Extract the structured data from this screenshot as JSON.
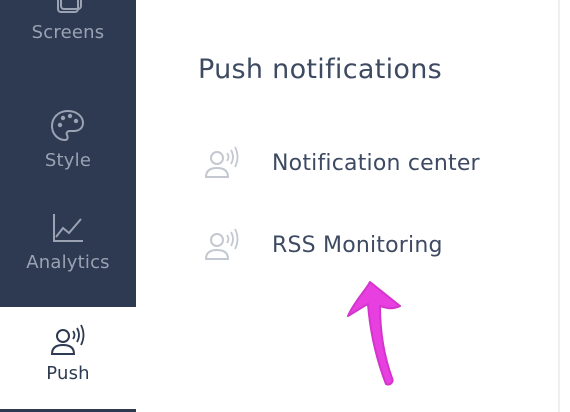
{
  "sidebar": {
    "items": [
      {
        "label": "Screens",
        "icon": "screens-icon"
      },
      {
        "label": "Style",
        "icon": "palette-icon"
      },
      {
        "label": "Analytics",
        "icon": "analytics-chart-icon"
      },
      {
        "label": "Push",
        "icon": "push-user-icon",
        "active": true
      }
    ]
  },
  "main": {
    "title": "Push notifications",
    "items": [
      {
        "label": "Notification center",
        "icon": "push-user-icon"
      },
      {
        "label": "RSS Monitoring",
        "icon": "push-user-icon"
      }
    ]
  },
  "annotation": {
    "arrow_color": "#e840e0",
    "points_to": "RSS Monitoring"
  },
  "colors": {
    "sidebar_bg": "#2e3a52",
    "sidebar_text": "#9aa2b3",
    "active_bg": "#ffffff",
    "text_primary": "#3d4a61",
    "icon_muted": "#c3c8d1"
  }
}
